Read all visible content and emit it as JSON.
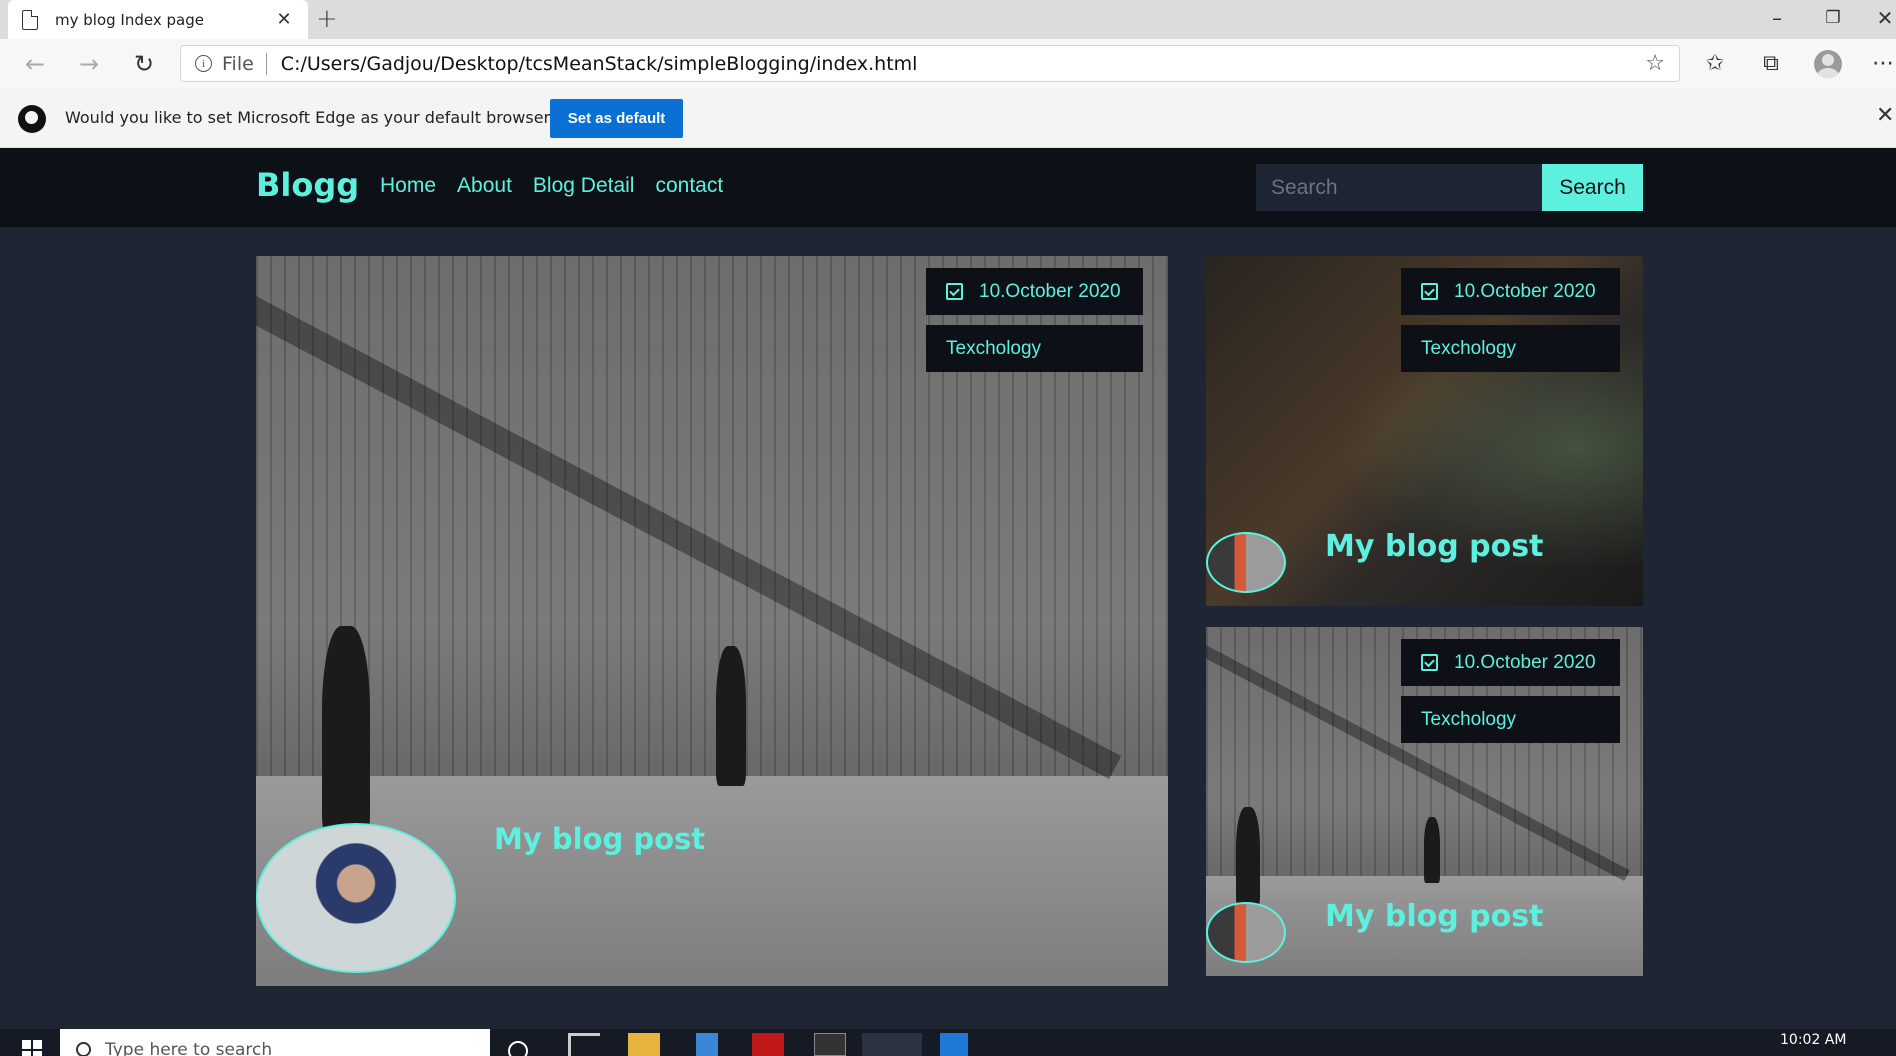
{
  "browser": {
    "tab_title": "my blog Index page",
    "address_scheme": "File",
    "url": "C:/Users/Gadjou/Desktop/tcsMeanStack/simpleBlogging/index.html"
  },
  "notification": {
    "message": "Would you like to set Microsoft Edge as your default browser?",
    "button_label": "Set as default"
  },
  "site": {
    "brand": "Blogg",
    "nav": [
      "Home",
      "About",
      "Blog Detail",
      "contact"
    ],
    "search_placeholder": "Search",
    "search_button": "Search",
    "accent_color": "#5ef0de"
  },
  "posts": [
    {
      "date": "10.October 2020",
      "category": "Texchology",
      "title": "My blog post"
    },
    {
      "date": "10.October 2020",
      "category": "Texchology",
      "title": "My blog post"
    },
    {
      "date": "10.October 2020",
      "category": "Texchology",
      "title": "My blog post"
    }
  ],
  "taskbar": {
    "search_placeholder": "Type here to search",
    "clock": "10:02 AM"
  }
}
